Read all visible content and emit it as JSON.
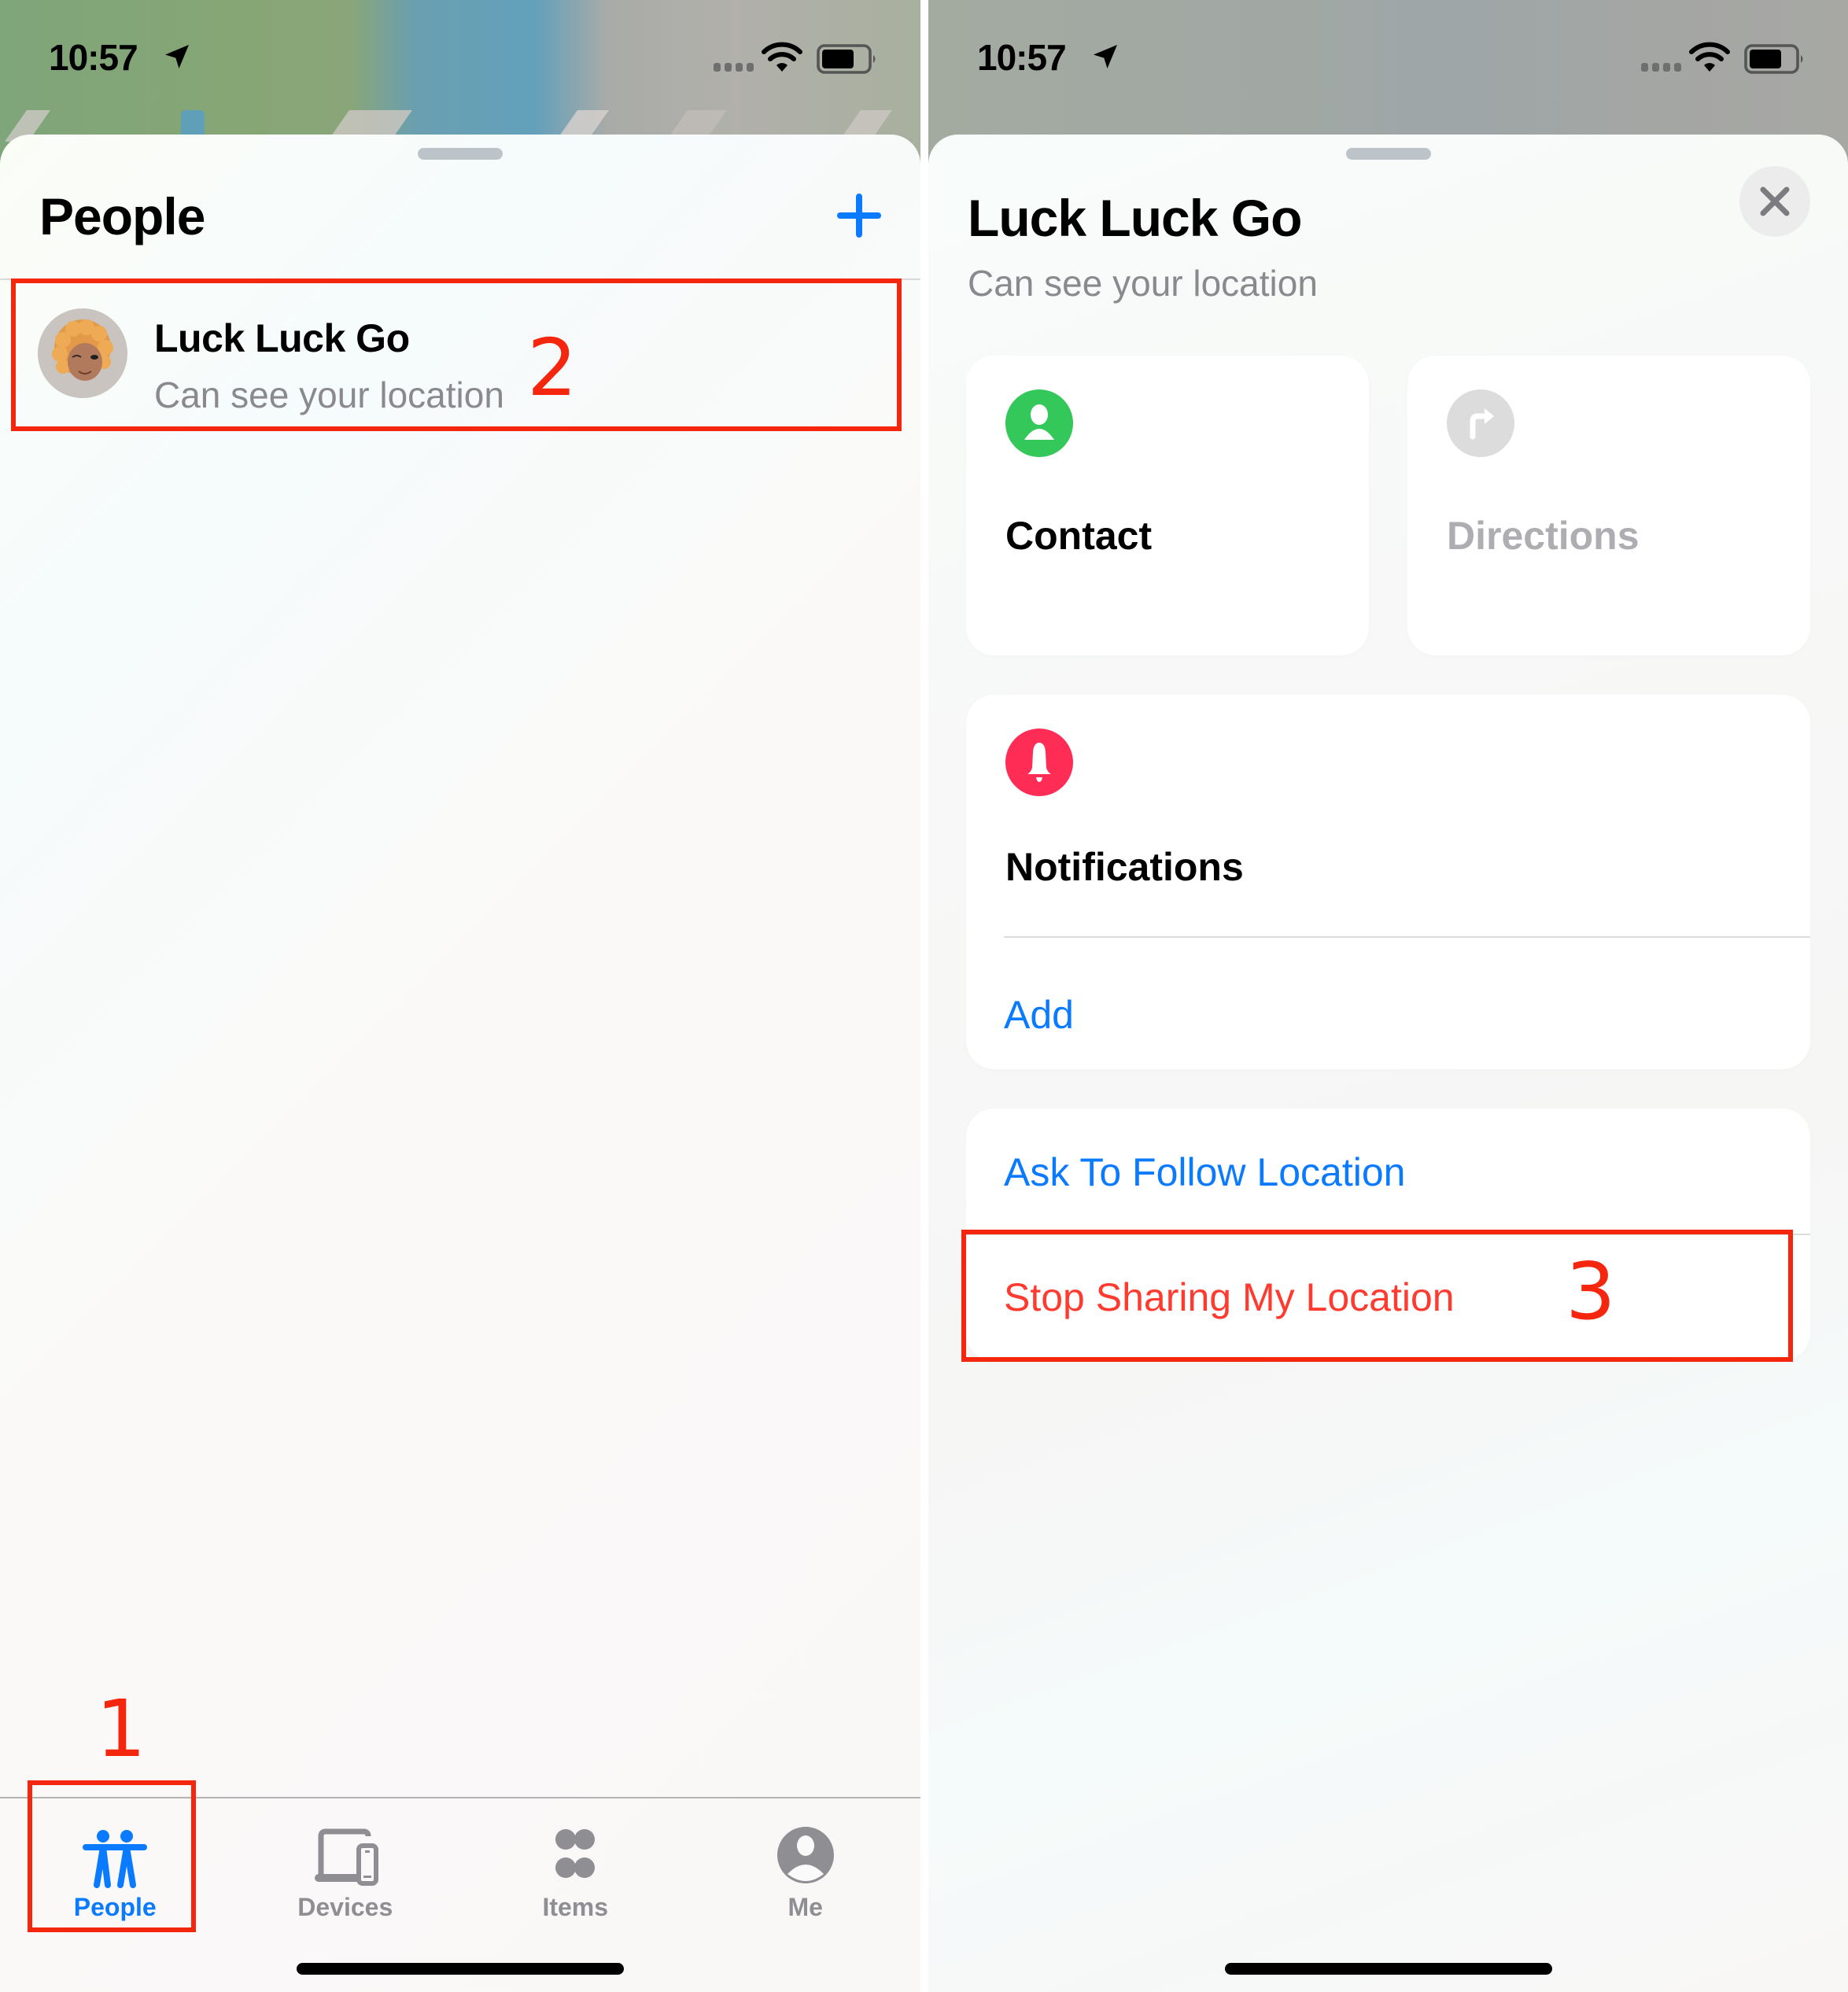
{
  "left_screen": {
    "status_bar": {
      "time": "10:57",
      "location_icon": "location-arrow-icon",
      "wifi_icon": "wifi-icon",
      "battery_icon": "battery-icon"
    },
    "header": {
      "title": "People",
      "add_button_icon": "plus-icon"
    },
    "people": [
      {
        "name": "Luck Luck Go",
        "status": "Can see your location",
        "avatar": "memoji-avatar"
      }
    ],
    "tabs": [
      {
        "label": "People",
        "icon": "people-icon",
        "active": true
      },
      {
        "label": "Devices",
        "icon": "devices-icon",
        "active": false
      },
      {
        "label": "Items",
        "icon": "items-icon",
        "active": false
      },
      {
        "label": "Me",
        "icon": "me-icon",
        "active": false
      }
    ]
  },
  "right_screen": {
    "status_bar": {
      "time": "10:57"
    },
    "header": {
      "title": "Luck Luck Go",
      "subtitle": "Can see your location",
      "close_icon": "close-icon"
    },
    "actions": [
      {
        "label": "Contact",
        "icon": "contact-icon",
        "enabled": true
      },
      {
        "label": "Directions",
        "icon": "directions-icon",
        "enabled": false
      }
    ],
    "notifications": {
      "title": "Notifications",
      "icon": "bell-icon",
      "add_label": "Add"
    },
    "sharing": {
      "ask_follow_label": "Ask To Follow Location",
      "stop_sharing_label": "Stop Sharing My Location"
    }
  },
  "annotations": [
    {
      "number": "1",
      "target": "People tab"
    },
    {
      "number": "2",
      "target": "Luck Luck Go row"
    },
    {
      "number": "3",
      "target": "Stop Sharing My Location"
    }
  ],
  "colors": {
    "accent_blue": "#0a7aff",
    "destructive_red": "#ff3b30",
    "contact_green": "#34c759",
    "bell_pink": "#ff2d55",
    "annotation_red": "#f5260e",
    "disabled_gray": "#aeaeb2"
  }
}
